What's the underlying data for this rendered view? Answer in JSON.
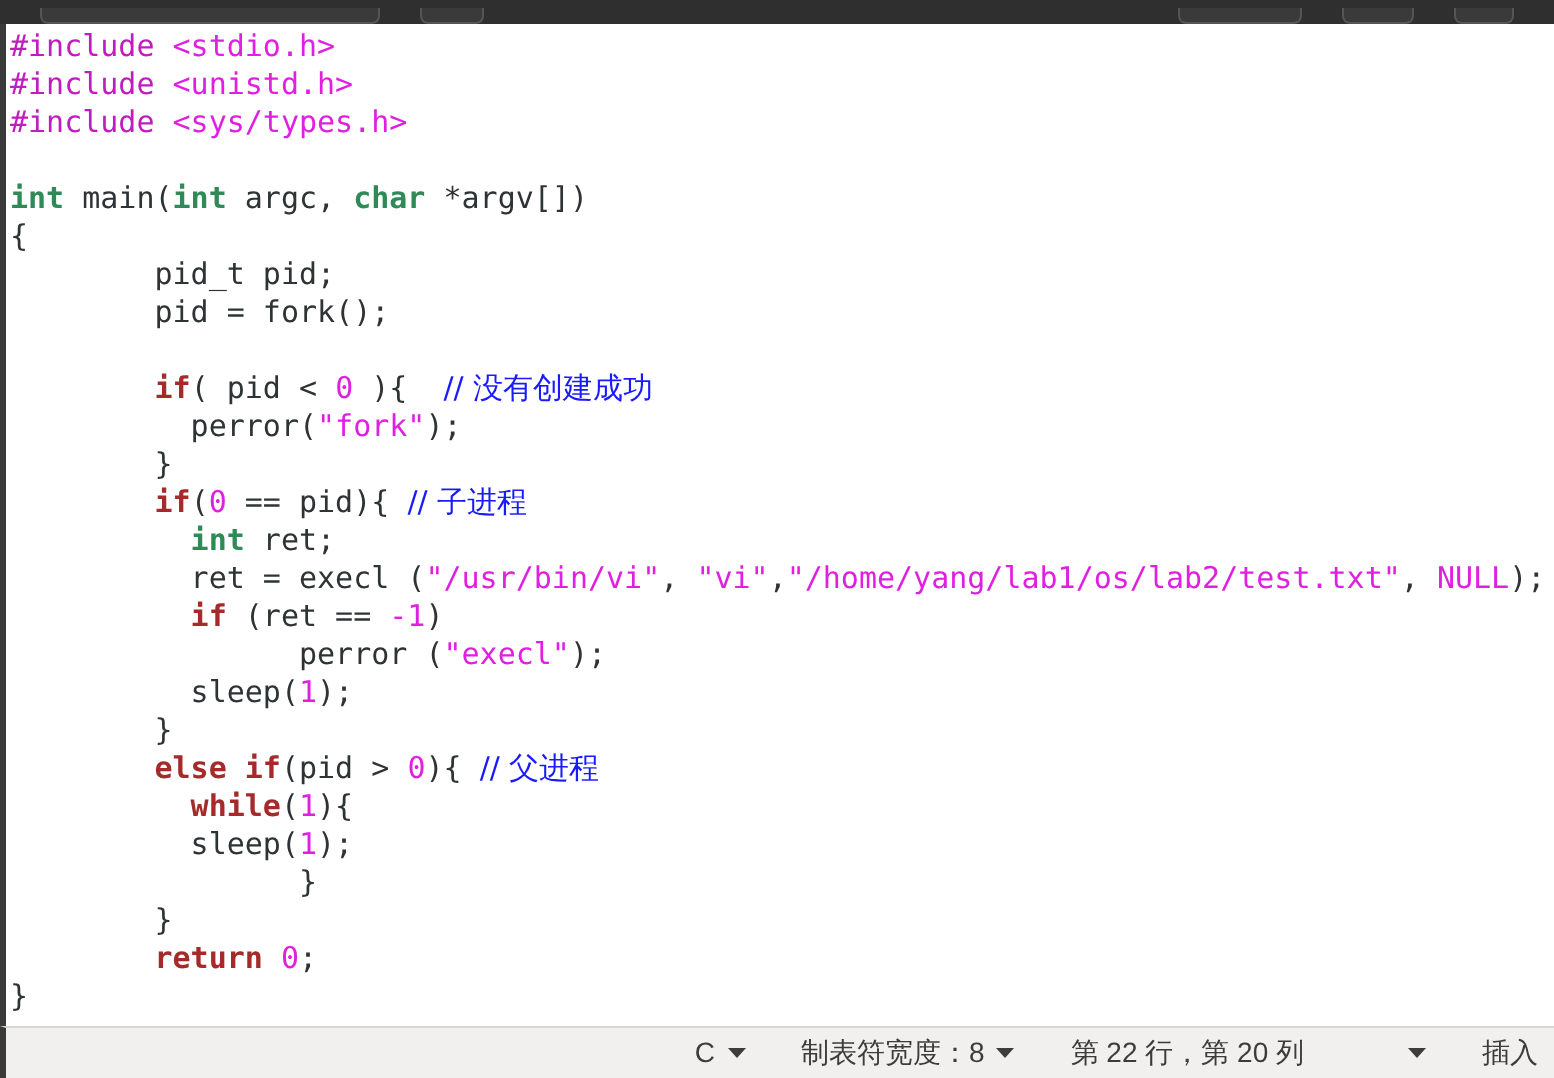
{
  "editor": {
    "lines": [
      {
        "kind": "code",
        "tokens": [
          {
            "kind": "pre",
            "text": "#include"
          },
          {
            "kind": "str",
            "text": " <stdio.h>"
          }
        ]
      },
      {
        "kind": "code",
        "tokens": [
          {
            "kind": "pre",
            "text": "#include"
          },
          {
            "kind": "str",
            "text": " <unistd.h>"
          }
        ]
      },
      {
        "kind": "code",
        "tokens": [
          {
            "kind": "pre",
            "text": "#include"
          },
          {
            "kind": "str",
            "text": " <sys/types.h>"
          }
        ]
      },
      {
        "kind": "blank"
      },
      {
        "kind": "code",
        "tokens": [
          {
            "kind": "type",
            "text": "int"
          },
          {
            "kind": "plain",
            "text": " main("
          },
          {
            "kind": "type",
            "text": "int"
          },
          {
            "kind": "plain",
            "text": " argc, "
          },
          {
            "kind": "type",
            "text": "char"
          },
          {
            "kind": "plain",
            "text": " *argv[])"
          }
        ]
      },
      {
        "kind": "code",
        "tokens": [
          {
            "kind": "plain",
            "text": "{"
          }
        ]
      },
      {
        "kind": "code",
        "tokens": [
          {
            "kind": "plain",
            "text": "        pid_t pid;"
          }
        ]
      },
      {
        "kind": "code",
        "tokens": [
          {
            "kind": "plain",
            "text": "        pid = fork();"
          }
        ]
      },
      {
        "kind": "blank"
      },
      {
        "kind": "code",
        "tokens": [
          {
            "kind": "kw",
            "text": "        if"
          },
          {
            "kind": "plain",
            "text": "( pid < "
          },
          {
            "kind": "num",
            "text": "0"
          },
          {
            "kind": "plain",
            "text": " ){  "
          },
          {
            "kind": "comment",
            "text": "// 没有创建成功"
          }
        ]
      },
      {
        "kind": "code",
        "tokens": [
          {
            "kind": "plain",
            "text": "          perror("
          },
          {
            "kind": "str",
            "text": "\"fork\""
          },
          {
            "kind": "plain",
            "text": ");"
          }
        ]
      },
      {
        "kind": "code",
        "tokens": [
          {
            "kind": "plain",
            "text": "        }"
          }
        ]
      },
      {
        "kind": "code",
        "tokens": [
          {
            "kind": "kw",
            "text": "        if"
          },
          {
            "kind": "plain",
            "text": "("
          },
          {
            "kind": "num",
            "text": "0"
          },
          {
            "kind": "plain",
            "text": " == pid){ "
          },
          {
            "kind": "comment",
            "text": "// 子进程"
          }
        ]
      },
      {
        "kind": "code",
        "tokens": [
          {
            "kind": "type",
            "text": "          int"
          },
          {
            "kind": "plain",
            "text": " ret;"
          }
        ]
      },
      {
        "kind": "code",
        "tokens": [
          {
            "kind": "plain",
            "text": "          ret = execl ("
          },
          {
            "kind": "str",
            "text": "\"/usr/bin/vi\""
          },
          {
            "kind": "plain",
            "text": ", "
          },
          {
            "kind": "str",
            "text": "\"vi\""
          },
          {
            "kind": "plain",
            "text": ","
          },
          {
            "kind": "str",
            "text": "\"/home/yang/lab1/os/lab2/test.txt\""
          },
          {
            "kind": "plain",
            "text": ", "
          },
          {
            "kind": "num",
            "text": "NULL"
          },
          {
            "kind": "plain",
            "text": ");"
          }
        ]
      },
      {
        "kind": "code",
        "tokens": [
          {
            "kind": "kw",
            "text": "          if"
          },
          {
            "kind": "plain",
            "text": " (ret == "
          },
          {
            "kind": "num",
            "text": "-1"
          },
          {
            "kind": "plain",
            "text": ")"
          }
        ]
      },
      {
        "kind": "code",
        "tokens": [
          {
            "kind": "plain",
            "text": "                perror ("
          },
          {
            "kind": "str",
            "text": "\"execl\""
          },
          {
            "kind": "plain",
            "text": ");"
          }
        ]
      },
      {
        "kind": "code",
        "tokens": [
          {
            "kind": "plain",
            "text": "          sleep("
          },
          {
            "kind": "num",
            "text": "1"
          },
          {
            "kind": "plain",
            "text": ");"
          }
        ]
      },
      {
        "kind": "code",
        "tokens": [
          {
            "kind": "plain",
            "text": "        }"
          }
        ]
      },
      {
        "kind": "code",
        "tokens": [
          {
            "kind": "kw",
            "text": "        else if"
          },
          {
            "kind": "plain",
            "text": "(pid > "
          },
          {
            "kind": "num",
            "text": "0"
          },
          {
            "kind": "plain",
            "text": "){ "
          },
          {
            "kind": "comment",
            "text": "// 父进程"
          }
        ]
      },
      {
        "kind": "code",
        "tokens": [
          {
            "kind": "kw",
            "text": "          while"
          },
          {
            "kind": "plain",
            "text": "("
          },
          {
            "kind": "num",
            "text": "1"
          },
          {
            "kind": "plain",
            "text": "){"
          }
        ]
      },
      {
        "kind": "code",
        "tokens": [
          {
            "kind": "plain",
            "text": "          sleep("
          },
          {
            "kind": "num",
            "text": "1"
          },
          {
            "kind": "plain",
            "text": ");"
          }
        ]
      },
      {
        "kind": "code",
        "tokens": [
          {
            "kind": "plain",
            "text": "                }"
          }
        ]
      },
      {
        "kind": "code",
        "tokens": [
          {
            "kind": "plain",
            "text": "        }"
          }
        ]
      },
      {
        "kind": "code",
        "tokens": [
          {
            "kind": "kw",
            "text": "        return"
          },
          {
            "kind": "num",
            "text": " 0"
          },
          {
            "kind": "plain",
            "text": ";"
          }
        ]
      },
      {
        "kind": "code",
        "tokens": [
          {
            "kind": "plain",
            "text": "}"
          }
        ]
      }
    ]
  },
  "status_bar": {
    "language": "C",
    "tab_width": "制表符宽度：8",
    "position": "第 22 行，第 20 列",
    "mode": "插入"
  }
}
